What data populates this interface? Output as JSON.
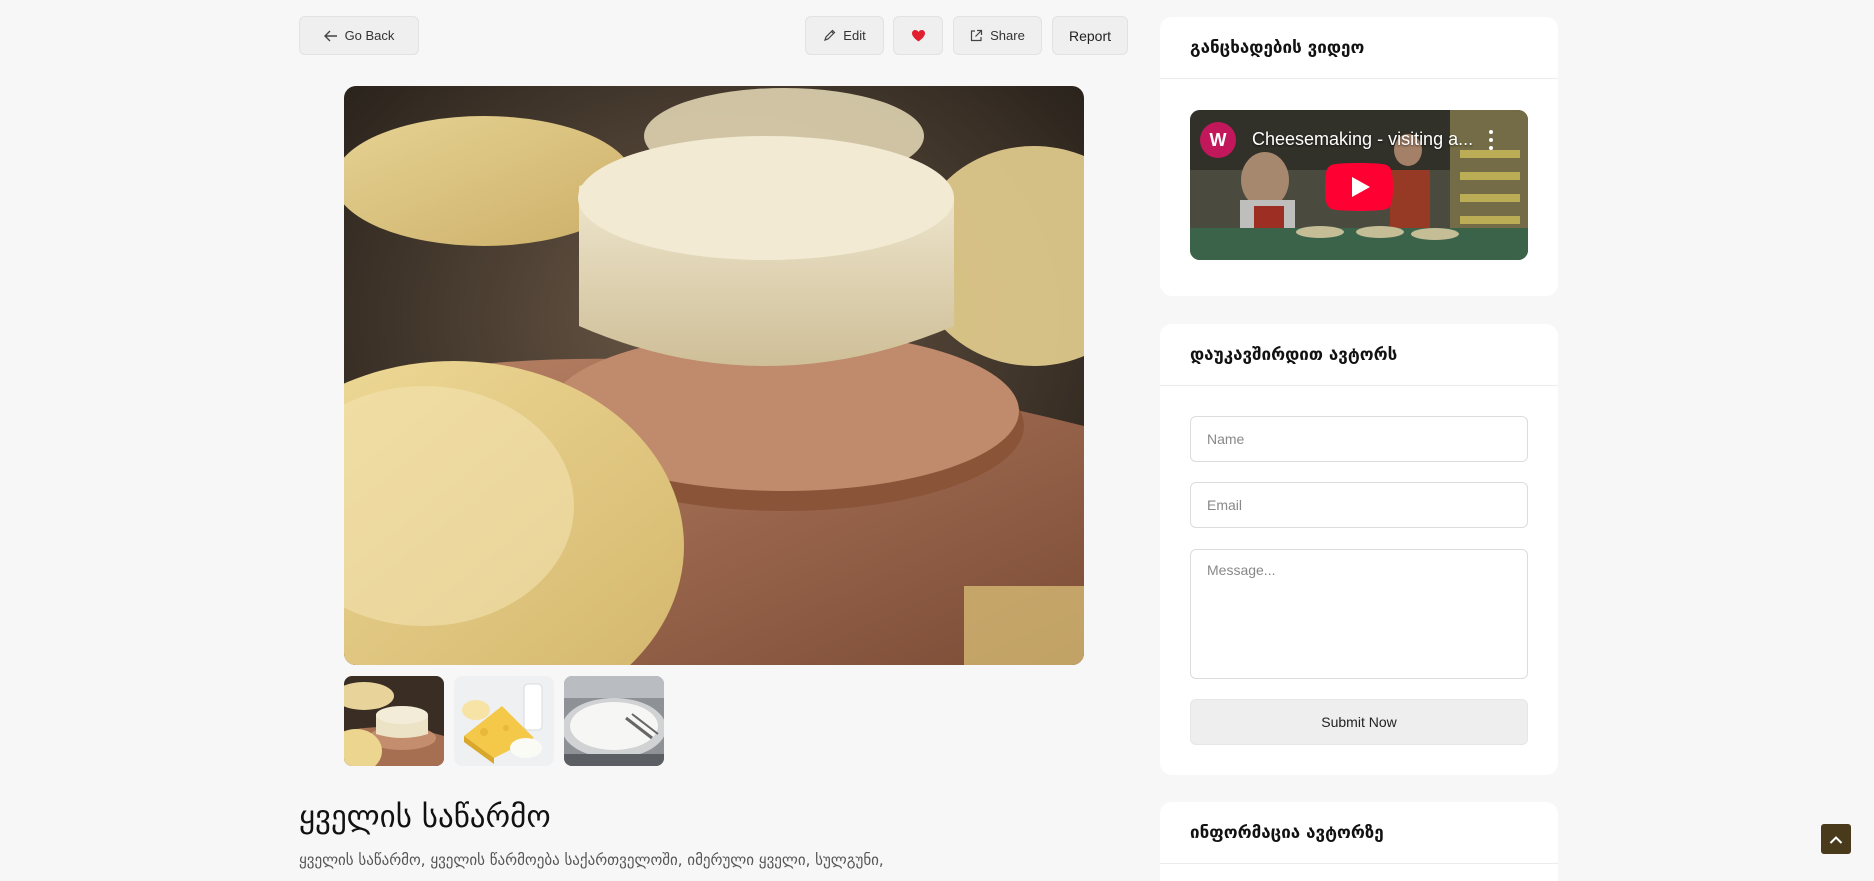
{
  "toolbar": {
    "back_label": "Go Back",
    "edit_label": "Edit",
    "share_label": "Share",
    "report_label": "Report",
    "favorite_color": "#e0202e"
  },
  "listing": {
    "title": "ყველის საწარმო",
    "description": "ყველის საწარმო, ყველის წარმოება საქართველოში, იმერული ყველი, სულგუნი,"
  },
  "gallery": {
    "main_image": "cheese-wheels-on-wooden-boards",
    "thumbnails": [
      "cheese-wheels",
      "assorted-cheese-and-milk",
      "cheese-vat-curd"
    ]
  },
  "sidebar": {
    "video_card": {
      "heading": "განცხადების ვიდეო",
      "video_title": "Cheesemaking - visiting a...",
      "channel_logo": "W"
    },
    "contact_card": {
      "heading": "დაუკავშირდით ავტორს",
      "name_placeholder": "Name",
      "email_placeholder": "Email",
      "message_placeholder": "Message...",
      "submit_label": "Submit Now"
    },
    "info_card": {
      "heading": "ინფორმაცია ავტორზე"
    }
  },
  "colors": {
    "accent": "#4a3a1c",
    "youtube_red": "#ff0033"
  }
}
